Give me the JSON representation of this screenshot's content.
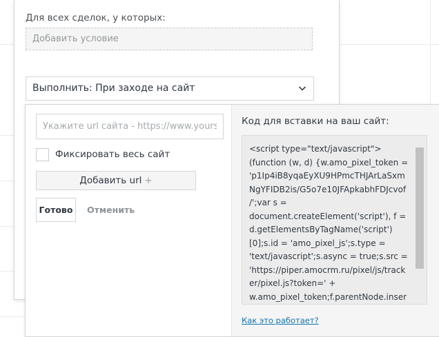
{
  "conditions": {
    "label": "Для всех сделок, у которых:",
    "add_condition": "Добавить условие"
  },
  "action_select": {
    "value": "Выполнить: При заходе на сайт",
    "icon": "chevron-down-icon"
  },
  "url_form": {
    "url_placeholder": "Укажите url сайта - https://www.yoursite",
    "fix_site_label": "Фиксировать весь сайт",
    "fix_site_checked": false,
    "add_url_label": "Добавить url",
    "add_url_plus": "+",
    "done_label": "Готово",
    "cancel_label": "Отменить"
  },
  "code_panel": {
    "title": "Код для вставки на ваш сайт:",
    "code": "<script type=\"text/javascript\">\n(function (w, d) {w.amo_pixel_token =\n'p1Ip4iB8yqaEyXU9HPmcTHJArLaSxm\nNgYFIDB2is/G5o7e10JFApkabhFDJcvof\n/';var s =\ndocument.createElement('script'), f =\nd.getElementsByTagName('script')\n[0];s.id = 'amo_pixel_js';s.type =\n'text/javascript';s.async = true;s.src =\n'https://piper.amocrm.ru/pixel/js/track\ner/pixel.js?token=' +\nw.amo_pixel_token;f.parentNode.inser",
    "scroll_position": 0,
    "how_link": "Как это работает?"
  },
  "colors": {
    "link": "#1375ab",
    "border": "#d4d5d8",
    "panel_bg": "#f5f5f5",
    "scroll_thumb": "#c1c1c1"
  }
}
